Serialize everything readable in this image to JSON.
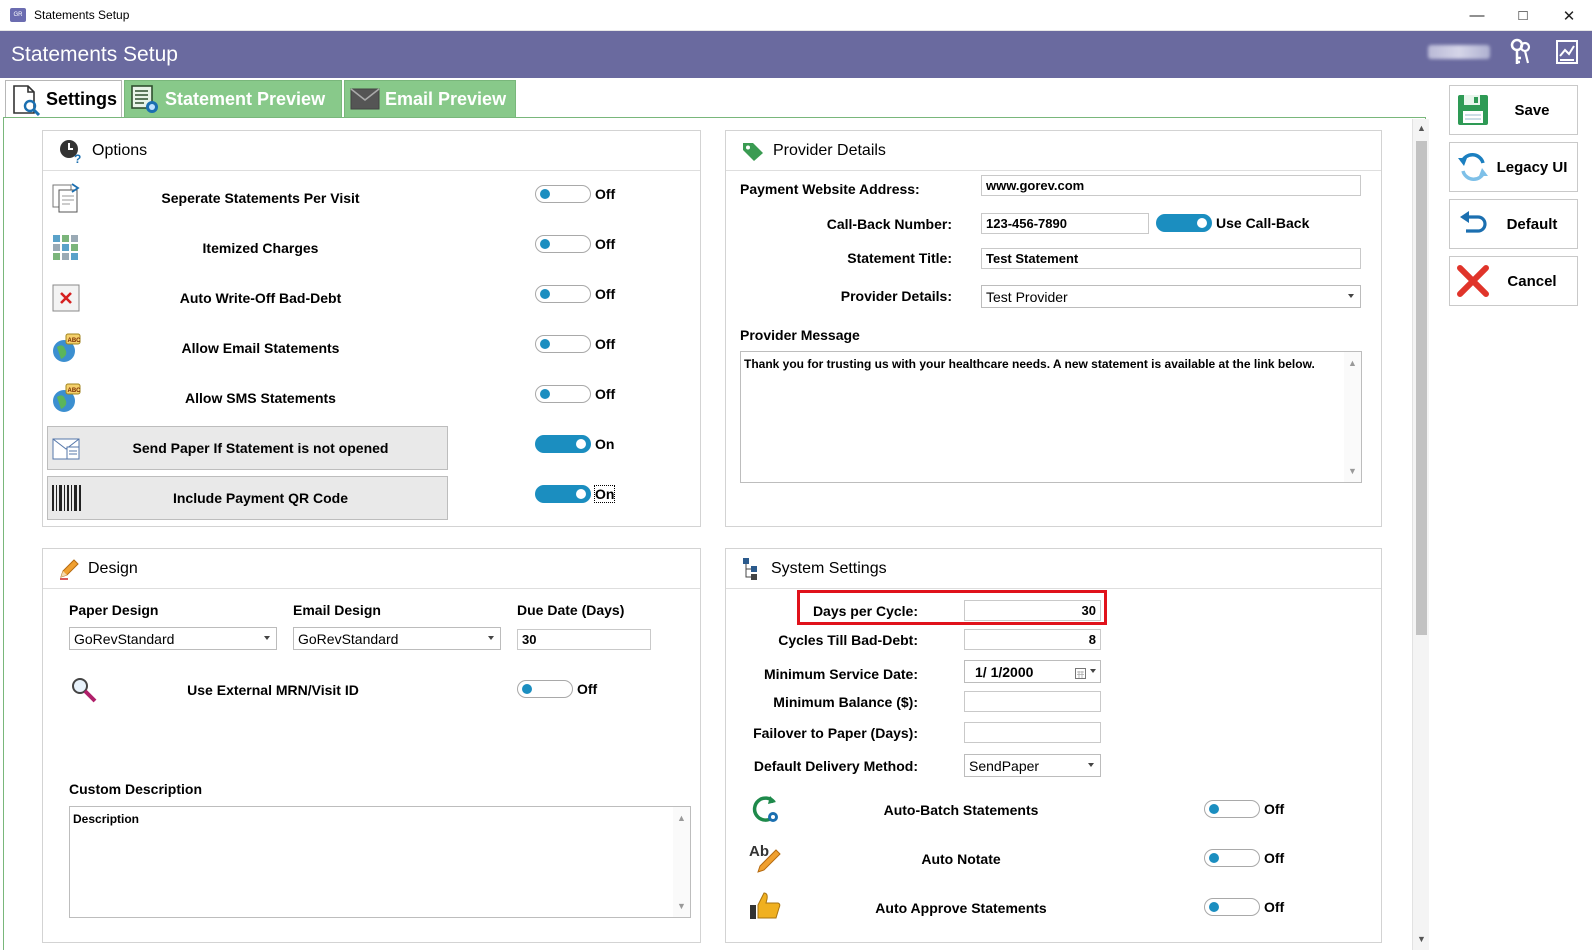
{
  "window": {
    "title": "Statements Setup"
  },
  "header": {
    "title": "Statements Setup"
  },
  "tabs": [
    {
      "label": "Settings"
    },
    {
      "label": "Statement Preview"
    },
    {
      "label": "Email Preview"
    }
  ],
  "options": {
    "title": "Options",
    "rows": [
      {
        "label": "Seperate Statements Per Visit",
        "state": "Off"
      },
      {
        "label": "Itemized Charges",
        "state": "Off"
      },
      {
        "label": "Auto Write-Off Bad-Debt",
        "state": "Off"
      },
      {
        "label": "Allow Email Statements",
        "state": "Off"
      },
      {
        "label": "Allow SMS Statements",
        "state": "Off"
      },
      {
        "label": "Send Paper If Statement is not opened",
        "state": "On"
      },
      {
        "label": "Include Payment QR Code",
        "state": "On"
      }
    ]
  },
  "provider": {
    "title": "Provider Details",
    "website_label": "Payment Website Address:",
    "website_value": "www.gorev.com",
    "callback_label": "Call-Back Number:",
    "callback_value": "123-456-7890",
    "use_callback_label": "Use Call-Back",
    "statement_title_label": "Statement Title:",
    "statement_title_value": "Test Statement",
    "provider_details_label": "Provider Details:",
    "provider_details_value": "Test Provider",
    "message_label": "Provider Message",
    "message_value": "Thank you for trusting us with your healthcare needs.  A new statement is available at the link below."
  },
  "design": {
    "title": "Design",
    "paper_label": "Paper Design",
    "paper_value": "GoRevStandard",
    "email_label": "Email Design",
    "email_value": "GoRevStandard",
    "due_label": "Due Date (Days)",
    "due_value": "30",
    "mrn_label": "Use External MRN/Visit ID",
    "mrn_state": "Off",
    "custom_desc_label": "Custom Description",
    "custom_desc_value": "Description"
  },
  "system": {
    "title": "System Settings",
    "days_label": "Days per Cycle:",
    "days_value": "30",
    "cycles_label": "Cycles Till Bad-Debt:",
    "cycles_value": "8",
    "min_date_label": "Minimum Service Date:",
    "min_date_value": "1/  1/2000",
    "min_balance_label": "Minimum Balance ($):",
    "min_balance_value": "",
    "failover_label": "Failover to Paper (Days):",
    "failover_value": "",
    "delivery_label": "Default Delivery Method:",
    "delivery_value": "SendPaper",
    "toggles": [
      {
        "label": "Auto-Batch Statements",
        "state": "Off"
      },
      {
        "label": "Auto Notate",
        "state": "Off"
      },
      {
        "label": "Auto Approve Statements",
        "state": "Off"
      }
    ]
  },
  "side_buttons": {
    "save": "Save",
    "legacy": "Legacy UI",
    "default": "Default",
    "cancel": "Cancel"
  },
  "colors": {
    "header": "#6a6a9f",
    "tab_inactive": "#88c98a",
    "toggle_on": "#1b8ec0",
    "highlight": "#e0121b"
  }
}
